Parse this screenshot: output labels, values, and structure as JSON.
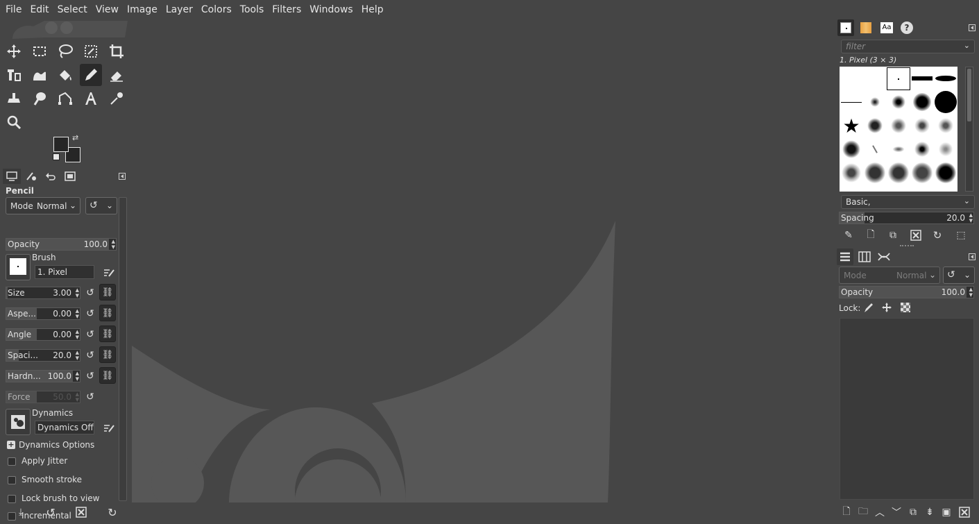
{
  "menubar": {
    "items": [
      "File",
      "Edit",
      "Select",
      "View",
      "Image",
      "Layer",
      "Colors",
      "Tools",
      "Filters",
      "Windows",
      "Help"
    ]
  },
  "tools": {
    "rows": [
      [
        "move-tool-icon",
        "rect-select-tool-icon",
        "free-select-tool-icon",
        "fuzzy-select-tool-icon",
        "crop-tool-icon"
      ],
      [
        "unified-transform-tool-icon",
        "warp-transform-tool-icon",
        "bucket-fill-tool-icon",
        "pencil-tool-icon",
        "eraser-tool-icon"
      ],
      [
        "clone-tool-icon",
        "smudge-tool-icon",
        "paths-tool-icon",
        "text-tool-icon",
        "color-picker-tool-icon"
      ],
      [
        "zoom-tool-icon"
      ]
    ],
    "active": "pencil-tool-icon"
  },
  "tool_options": {
    "title": "Pencil",
    "mode_label": "Mode",
    "mode_value": "Normal",
    "opacity_label": "Opacity",
    "opacity_value": "100.0",
    "brush_label": "Brush",
    "brush_value": "1. Pixel",
    "size_label": "Size",
    "size_value": "3.00",
    "aspect_label": "Aspe...",
    "aspect_value": "0.00",
    "angle_label": "Angle",
    "angle_value": "0.00",
    "spacing_label": "Spaci...",
    "spacing_value": "20.0",
    "hardness_label": "Hardn...",
    "hardness_value": "100.0",
    "force_label": "Force",
    "force_value": "50.0",
    "dynamics_label": "Dynamics",
    "dynamics_value": "Dynamics Off",
    "dynamics_options": "Dynamics Options",
    "checkboxes": [
      "Apply Jitter",
      "Smooth stroke",
      "Lock brush to view",
      "Incremental"
    ]
  },
  "brushes_panel": {
    "filter_placeholder": "filter",
    "current_brush": "1. Pixel (3 × 3)",
    "tag_value": "Basic,",
    "spacing_label": "Spacing",
    "spacing_value": "20.0"
  },
  "layers_panel": {
    "mode_label": "Mode",
    "mode_value": "Normal",
    "opacity_label": "Opacity",
    "opacity_value": "100.0",
    "lock_label": "Lock:"
  },
  "colors": {
    "accent": "#2a2a2a",
    "canvas_bg": "#454545",
    "wilber": "#575757"
  }
}
